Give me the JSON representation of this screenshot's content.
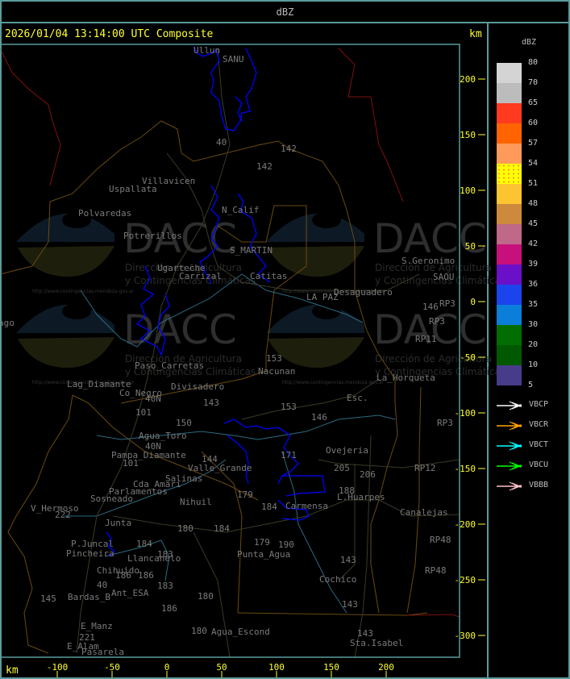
{
  "header": {
    "title": "dBZ"
  },
  "main": {
    "title": "2026/01/04 13:14:00 UTC Composite",
    "unit_top": "km",
    "unit_bottom": "km"
  },
  "axes": {
    "y_ticks": [
      "200",
      "150",
      "100",
      "50",
      "0",
      "-50",
      "-100",
      "-150",
      "-200",
      "-250",
      "-300"
    ],
    "x_ticks": [
      "-100",
      "-50",
      "0",
      "50",
      "100",
      "150",
      "200"
    ]
  },
  "legend": {
    "title": "dBZ",
    "bins": [
      {
        "label": "80",
        "color": "#d4d4d4"
      },
      {
        "label": "70",
        "color": "#bcbcbc"
      },
      {
        "label": "65",
        "color": "#ff3a1e"
      },
      {
        "label": "60",
        "color": "#ff6400"
      },
      {
        "label": "57",
        "color": "#ff9a5a"
      },
      {
        "label": "54",
        "color": "#ffff00"
      },
      {
        "label": "51",
        "color": "#fcc431"
      },
      {
        "label": "48",
        "color": "#cd8a3c"
      },
      {
        "label": "45",
        "color": "#bf6888"
      },
      {
        "label": "42",
        "color": "#c8107c"
      },
      {
        "label": "39",
        "color": "#6a10c8"
      },
      {
        "label": "36",
        "color": "#1c44ec"
      },
      {
        "label": "35",
        "color": "#0a7ed8"
      },
      {
        "label": "30",
        "color": "#006e00"
      },
      {
        "label": "20",
        "color": "#005800"
      },
      {
        "label": "10",
        "color": "#463c8a"
      }
    ],
    "last_label": "5",
    "arrows": [
      {
        "label": "VBCP",
        "color": "#ffffff"
      },
      {
        "label": "VBCR",
        "color": "#ffa500"
      },
      {
        "label": "VBCT",
        "color": "#00ffff"
      },
      {
        "label": "VBCU",
        "color": "#00ff00"
      },
      {
        "label": "VBBB",
        "color": "#ffc0cb"
      }
    ]
  },
  "watermark": {
    "logo": "DACC",
    "line1": "Dirección de Agricultura",
    "line2": "y Contingencias Climáticas",
    "url": "http://www.contingencias.mendoza.gov.ar"
  },
  "map": {
    "labels": [
      "Ullun",
      "SANU",
      "Villavicen",
      "Uspallata",
      "Polvaredas",
      "N_Calif",
      "Potrerillos",
      "S_MARTIN",
      "Ugarteche",
      "Carrizal",
      "Catitas",
      "LA PAZ",
      "Desaguadero",
      "S.Geronimo",
      "SAOU",
      "RP3",
      "RP3",
      "RP11",
      "146",
      "153",
      "Nacunan",
      "La_Horqueta",
      "Lag_Diamante",
      "Co_Negro",
      "Divisadero",
      "Paso_Carretas",
      "143",
      "Esc.",
      "146",
      "153",
      "150",
      "Agua_Toro",
      "Pampa_Diamante",
      "101",
      "101",
      "Valle_Grande",
      "144",
      "Salinas",
      "Cda_Amari",
      "Parlamentos",
      "Sosneado",
      "Nihuil",
      "V_Hermoso",
      "222",
      "Junta",
      "P.Juncal",
      "Pincheira",
      "Llancanelo",
      "Chihuido",
      "Ant_ESA",
      "Bardas_B",
      "145",
      "E_Manz",
      "221",
      "E_Alam",
      "Pasarela",
      "Agua_Escond",
      "Punta_Agua",
      "Carmensa",
      "L.Huarpes",
      "Canalejas",
      "RP48",
      "RP48",
      "Cochico",
      "143",
      "143",
      "143",
      "Sta.Isabel",
      "Ovejeria",
      "205",
      "206",
      "188",
      "RP12",
      "RP3",
      "179",
      "184",
      "179",
      "190",
      "180",
      "184",
      "184",
      "183",
      "186",
      "186",
      "183",
      "180",
      "186",
      "180",
      "40",
      "142",
      "142",
      "40",
      "40N",
      "40N",
      "171",
      "ago"
    ],
    "echo_color": "#0000ff"
  }
}
